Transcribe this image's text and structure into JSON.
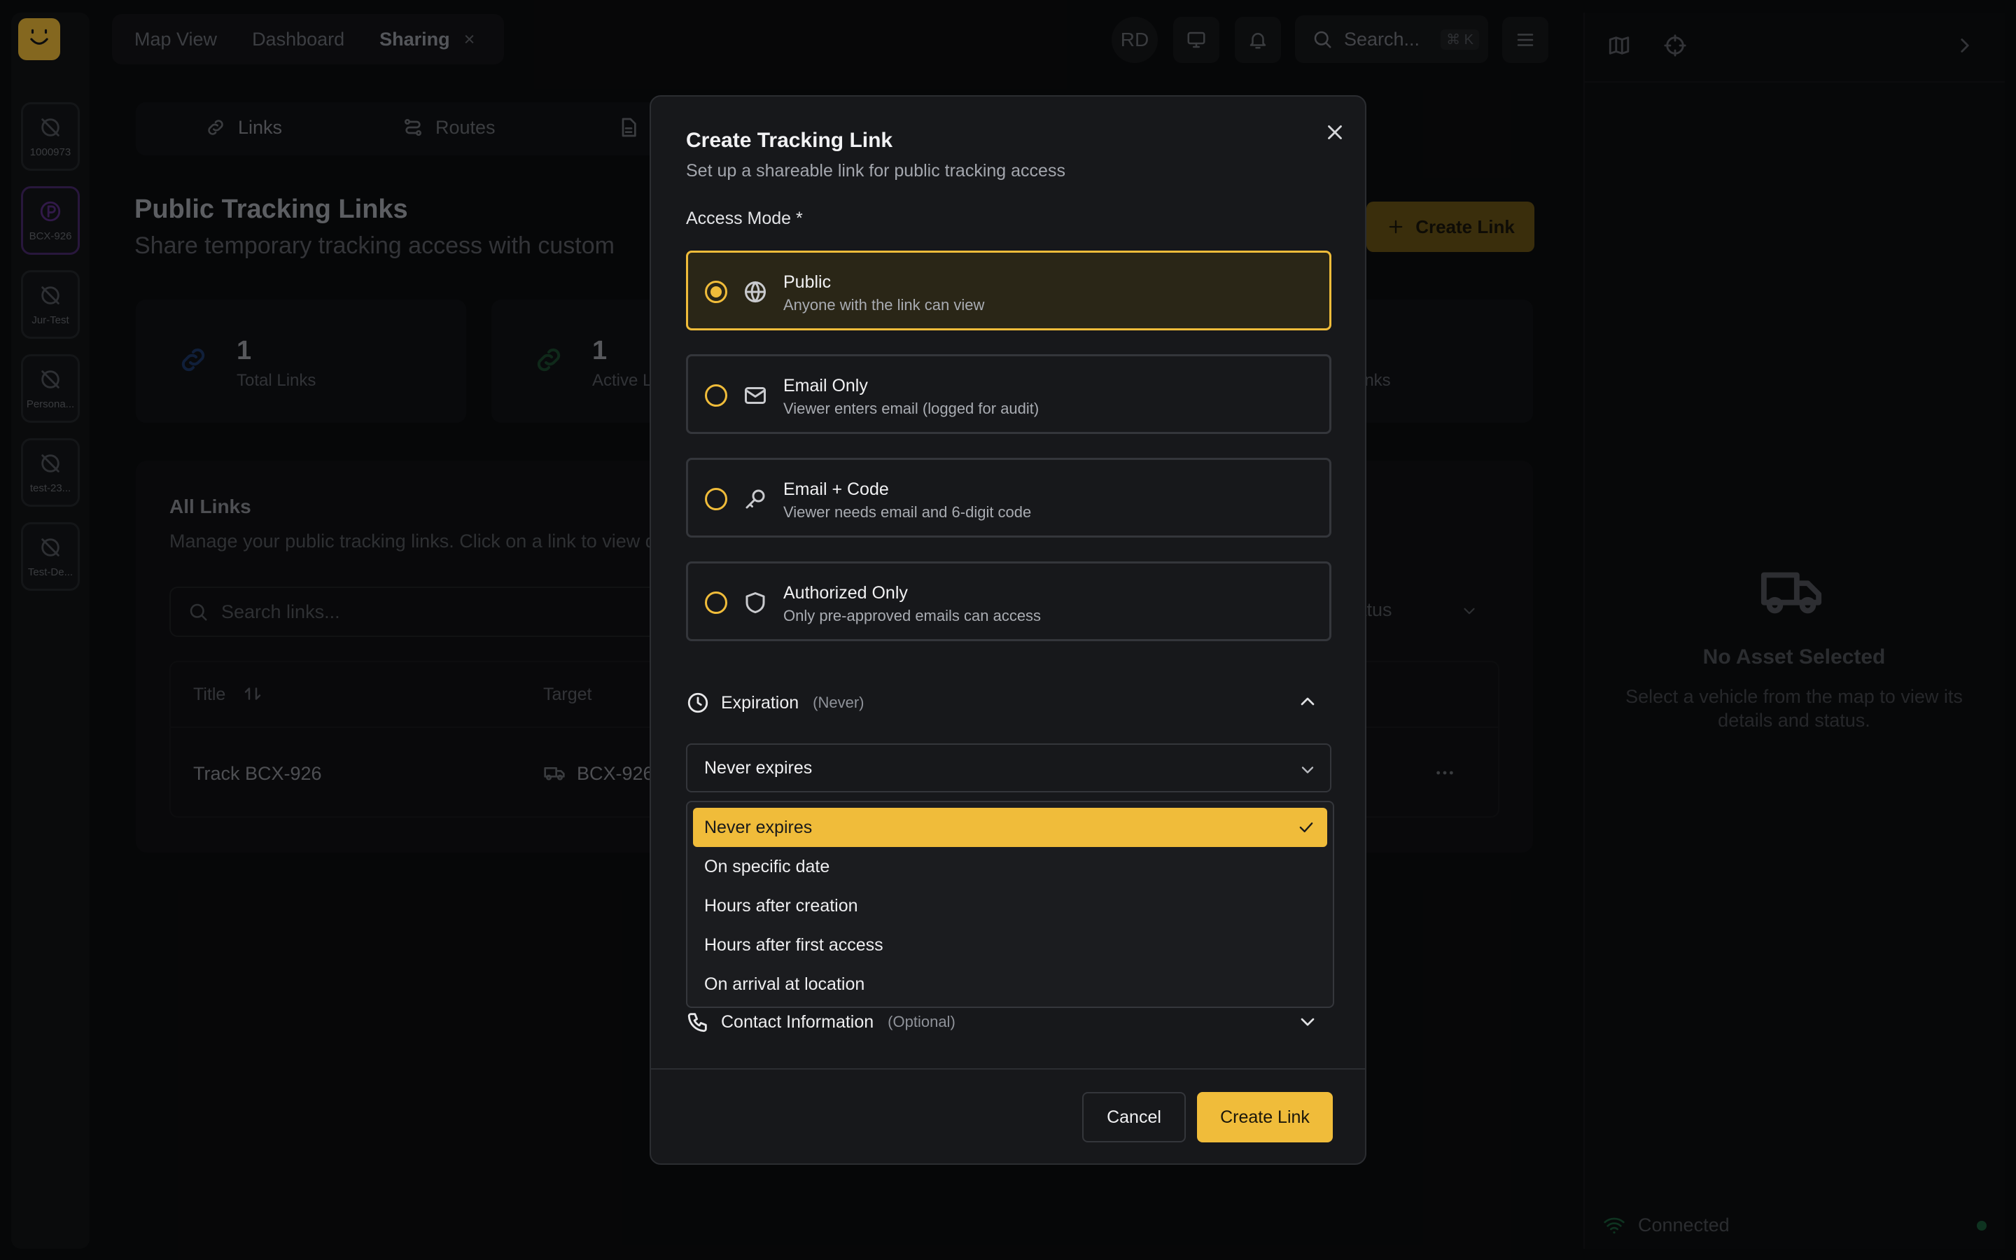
{
  "app": {
    "top_tabs": [
      {
        "label": "Map View"
      },
      {
        "label": "Dashboard"
      },
      {
        "label": "Sharing",
        "close": "×"
      }
    ],
    "user_initials": "RD",
    "search": {
      "placeholder": "Search...",
      "shortcut": "⌘ K"
    }
  },
  "rail": {
    "assets": [
      {
        "label": "1000973"
      },
      {
        "label": "BCX-926"
      },
      {
        "label": "Jur-Test"
      },
      {
        "label": "Persona..."
      },
      {
        "label": "test-23..."
      },
      {
        "label": "Test-De..."
      }
    ]
  },
  "page": {
    "sub_tabs": [
      {
        "label": "Links"
      },
      {
        "label": "Routes"
      }
    ],
    "title": "Public Tracking Links",
    "subtitle": "Share temporary tracking access with custom",
    "create_button": "Create Link",
    "stats": [
      {
        "value": "1",
        "label": "Total Links"
      },
      {
        "value": "1",
        "label": "Active L"
      },
      {
        "label": "inks"
      }
    ],
    "links_card": {
      "title": "All Links",
      "subtitle": "Manage your public tracking links. Click on a link to view d",
      "search_placeholder": "Search links...",
      "status_filter": "tatus",
      "columns": {
        "title": "Title",
        "target": "Target"
      },
      "rows": [
        {
          "title": "Track BCX-926",
          "target": "BCX-926"
        }
      ]
    }
  },
  "right_panel": {
    "empty_title": "No Asset Selected",
    "empty_subtitle": "Select a vehicle from the map to view its details and status.",
    "connection": "Connected"
  },
  "modal": {
    "title": "Create Tracking Link",
    "subtitle": "Set up a shareable link for public tracking access",
    "access_mode_label": "Access Mode *",
    "access_options": [
      {
        "title": "Public",
        "description": "Anyone with the link can view",
        "icon": "globe-icon",
        "selected": true
      },
      {
        "title": "Email Only",
        "description": "Viewer enters email (logged for audit)",
        "icon": "mail-icon",
        "selected": false
      },
      {
        "title": "Email + Code",
        "description": "Viewer needs email and 6-digit code",
        "icon": "key-icon",
        "selected": false
      },
      {
        "title": "Authorized Only",
        "description": "Only pre-approved emails can access",
        "icon": "shield-icon",
        "selected": false
      }
    ],
    "expiration": {
      "label": "Expiration",
      "note": "(Never)",
      "selected": "Never expires",
      "options": [
        "Never expires",
        "On specific date",
        "Hours after creation",
        "Hours after first access",
        "On arrival at location"
      ]
    },
    "contact": {
      "label": "Contact Information",
      "note": "(Optional)"
    },
    "cancel_label": "Cancel",
    "create_label": "Create Link"
  },
  "colors": {
    "accent": "#f0bc3a",
    "background": "#0c0d0f",
    "modal": "#17181b"
  }
}
